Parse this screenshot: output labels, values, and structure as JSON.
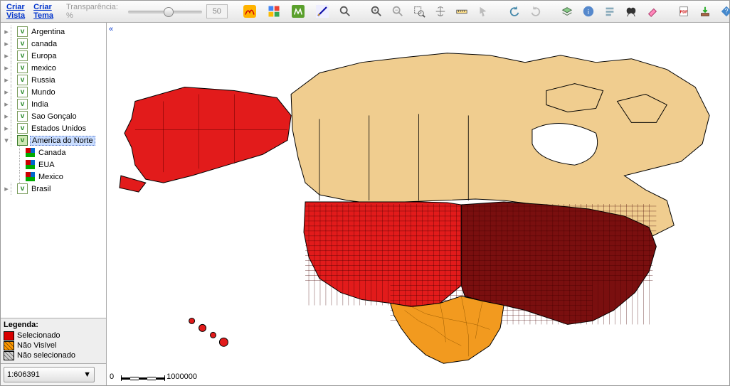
{
  "top": {
    "criar_vista": "Criar Vista",
    "criar_tema": "Criar Tema",
    "transp_label": "Transparência: %",
    "transp_value": "50"
  },
  "toolbar": {
    "icons": [
      "terraview",
      "google",
      "wikimapia",
      "draw",
      "search",
      "zoom-in",
      "zoom-out",
      "zoom-area",
      "pan",
      "measure",
      "pointer",
      "undo",
      "redo",
      "layer-up",
      "info",
      "query",
      "find",
      "eraser",
      "export-pdf",
      "download",
      "help"
    ]
  },
  "tree": {
    "items": [
      {
        "label": "Argentina"
      },
      {
        "label": "canada"
      },
      {
        "label": "Europa"
      },
      {
        "label": "mexico"
      },
      {
        "label": "Russia"
      },
      {
        "label": "Mundo"
      },
      {
        "label": "India"
      },
      {
        "label": "Sao Gonçalo"
      },
      {
        "label": "Estados Unidos"
      },
      {
        "label": "America do Norte",
        "selected": true,
        "expanded": true,
        "children": [
          {
            "label": "Canada"
          },
          {
            "label": "EUA"
          },
          {
            "label": "Mexico"
          }
        ]
      },
      {
        "label": "Brasil"
      }
    ]
  },
  "legend": {
    "title": "Legenda:",
    "rows": [
      {
        "color": "#d80000",
        "label": "Selecionado"
      },
      {
        "color": "#ff9900",
        "label": "Não Visível",
        "hatch": true
      },
      {
        "color": "#d0d0d0",
        "label": "Não selecionado",
        "hatch": true
      }
    ]
  },
  "scale": {
    "value": "1:606391",
    "bar_min": "0",
    "bar_max": "1000000"
  },
  "map": {
    "regions": {
      "canada": "#f0cd8f",
      "usa_west": "#e21b1b",
      "usa_east": "#7a0f0f",
      "alaska": "#e21b1b",
      "mexico": "#f29a1f"
    }
  }
}
